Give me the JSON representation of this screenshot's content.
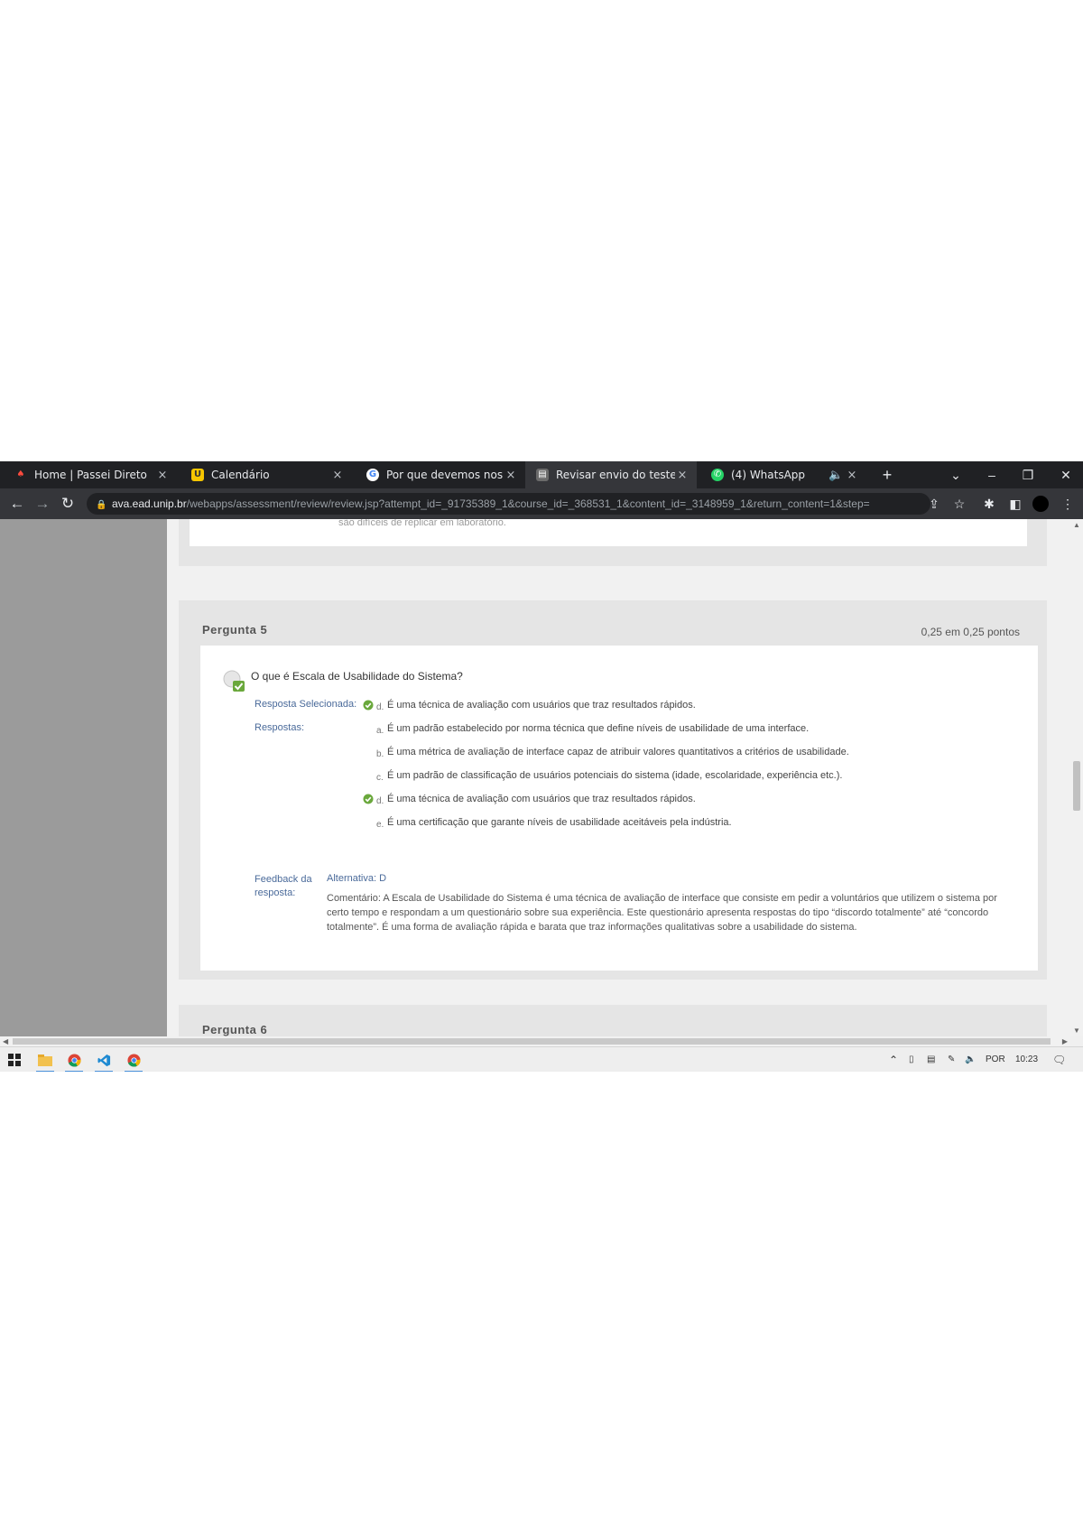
{
  "browser": {
    "tabs": [
      {
        "title": "Home | Passei Direto",
        "favicon": "passei-direto-icon",
        "close": "×"
      },
      {
        "title": "Calendário",
        "favicon": "calendar-u-icon",
        "close": "×"
      },
      {
        "title": "Por que devemos nos preoc",
        "favicon": "google-icon",
        "close": "×"
      },
      {
        "title": "Revisar envio do teste: QUES",
        "favicon": "blackboard-icon",
        "close": "×",
        "active": true
      },
      {
        "title": "(4) WhatsApp",
        "favicon": "whatsapp-icon",
        "close": "×",
        "muted": true
      }
    ],
    "new_tab": "+",
    "window_controls": {
      "dropdown": "⌄",
      "minimize": "–",
      "maximize": "❐",
      "close": "✕"
    },
    "url_host": "ava.ead.unip.br",
    "url_path": "/webapps/assessment/review/review.jsp?attempt_id=_91735389_1&course_id=_368531_1&content_id=_3148959_1&return_content=1&step="
  },
  "prev_question_tail": "são difíceis de replicar em laboratório.",
  "question": {
    "title": "Pergunta 5",
    "points": "0,25 em 0,25 pontos",
    "text": "O que é Escala de Usabilidade do Sistema?",
    "selected_label": "Resposta Selecionada:",
    "answers_label": "Respostas:",
    "selected_answer": {
      "letter": "d.",
      "text": "É uma técnica de avaliação com usuários que traz resultados rápidos."
    },
    "options": [
      {
        "letter": "a.",
        "text": "É um padrão estabelecido por norma técnica que define níveis de usabilidade de uma interface.",
        "correct": false
      },
      {
        "letter": "b.",
        "text": "É uma métrica de avaliação de interface capaz de atribuir valores quantitativos a critérios de usabilidade.",
        "correct": false
      },
      {
        "letter": "c.",
        "text": "É um padrão de classificação de usuários potenciais do sistema (idade, escolaridade, experiência etc.).",
        "correct": false
      },
      {
        "letter": "d.",
        "text": "É uma técnica de avaliação com usuários que traz resultados rápidos.",
        "correct": true
      },
      {
        "letter": "e.",
        "text": "É uma certificação que garante níveis de usabilidade aceitáveis pela indústria.",
        "correct": false
      }
    ],
    "feedback_label": "Feedback da resposta:",
    "feedback_answer": "Alternativa: D",
    "feedback_comment": "Comentário: A Escala de Usabilidade do Sistema é uma técnica de avaliação de interface que consiste em pedir a voluntários que utilizem o sistema por certo tempo e respondam a um questionário sobre sua experiência. Este questionário apresenta respostas do tipo “discordo totalmente” até “concordo totalmente”. É uma forma de avaliação rápida e barata que traz informações qualitativas sobre a usabilidade do sistema."
  },
  "next_question": {
    "title": "Pergunta 6"
  },
  "taskbar": {
    "apps": [
      "windows-start-icon",
      "file-explorer-icon",
      "chrome-icon",
      "vscode-icon",
      "chrome-icon"
    ],
    "tray": {
      "lang": "POR",
      "time": "10:23"
    }
  },
  "colors": {
    "check_green": "#6aa83c",
    "link_blue": "#4a6a9a",
    "tabbar": "#202124"
  }
}
